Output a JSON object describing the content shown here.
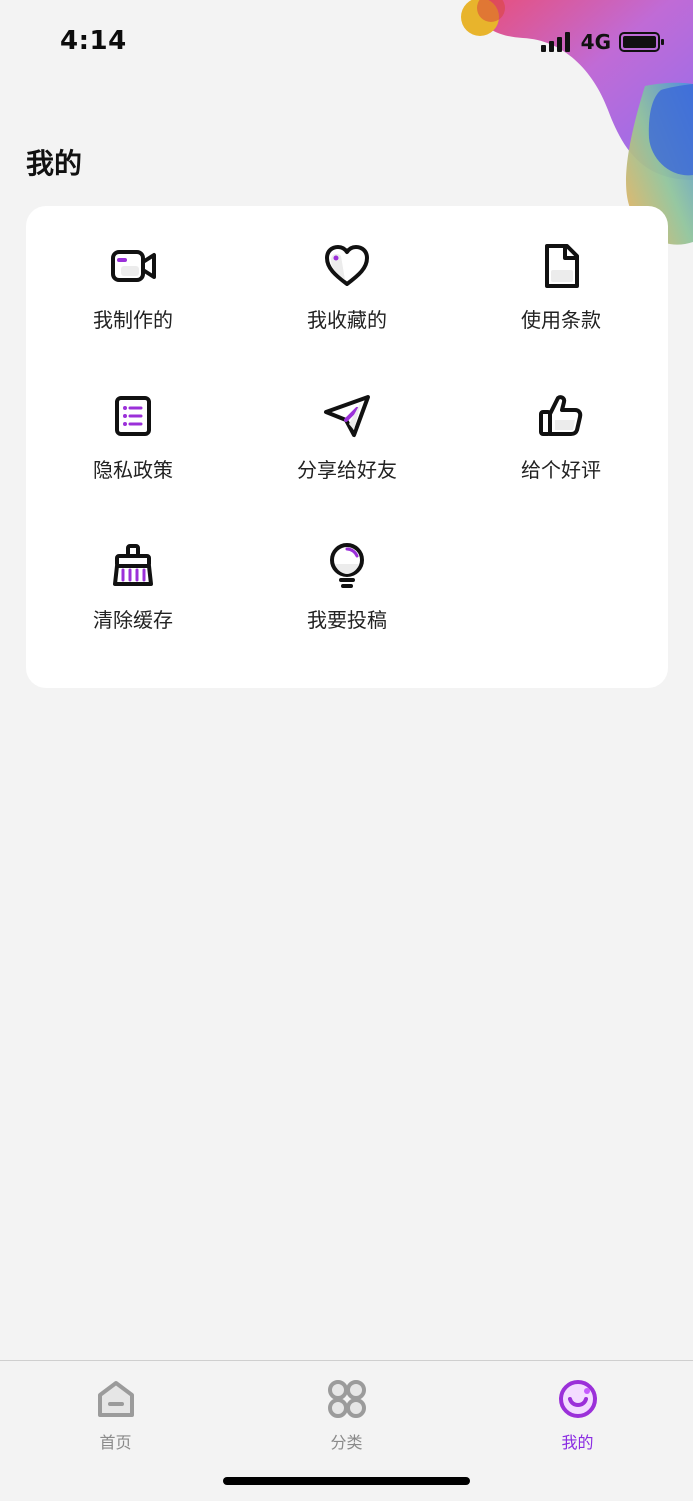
{
  "status": {
    "time": "4:14",
    "network": "4G"
  },
  "page": {
    "title": "我的"
  },
  "menu": {
    "items": [
      {
        "label": "我制作的",
        "icon": "video-camera-icon"
      },
      {
        "label": "我收藏的",
        "icon": "heart-icon"
      },
      {
        "label": "使用条款",
        "icon": "document-icon"
      },
      {
        "label": "隐私政策",
        "icon": "list-icon"
      },
      {
        "label": "分享给好友",
        "icon": "paper-plane-icon"
      },
      {
        "label": "给个好评",
        "icon": "thumbs-up-icon"
      },
      {
        "label": "清除缓存",
        "icon": "broom-icon"
      },
      {
        "label": "我要投稿",
        "icon": "lightbulb-icon"
      }
    ]
  },
  "tabbar": {
    "tabs": [
      {
        "label": "首页",
        "icon": "home-icon",
        "active": false
      },
      {
        "label": "分类",
        "icon": "category-icon",
        "active": false
      },
      {
        "label": "我的",
        "icon": "profile-smile-icon",
        "active": true
      }
    ]
  },
  "colors": {
    "accent": "#8a2be2",
    "background": "#f3f3f3",
    "card": "#ffffff"
  }
}
